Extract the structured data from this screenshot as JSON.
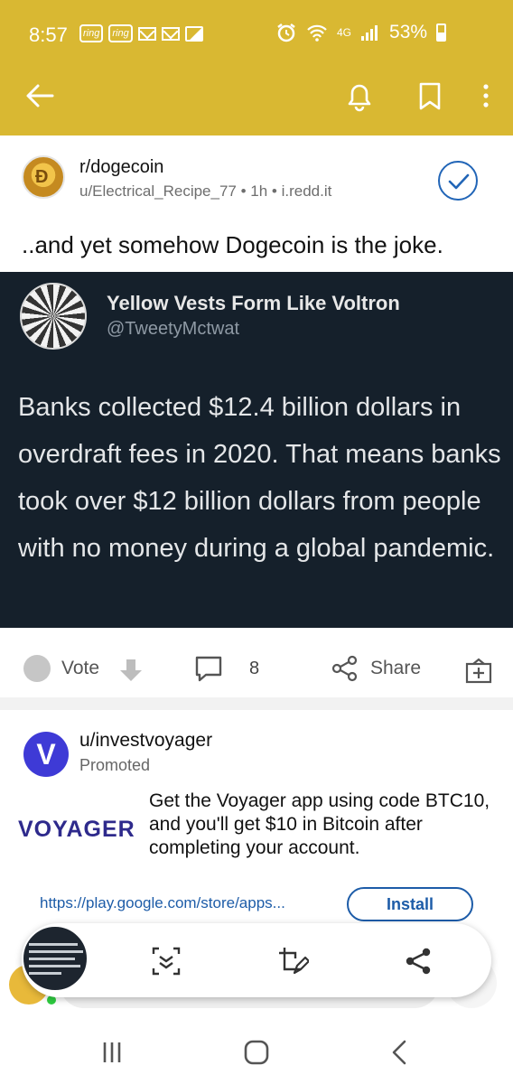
{
  "status_bar": {
    "time": "8:57",
    "ring_label_1": "ring",
    "ring_label_2": "ring",
    "network": "4G",
    "battery": "53%"
  },
  "app_bar": {
    "back_icon": "arrow-left-icon",
    "icons": [
      "bell-icon",
      "bookmark-icon",
      "more-vert-icon"
    ],
    "color": "#d9b832"
  },
  "post": {
    "subreddit": "r/dogecoin",
    "meta": "u/Electrical_Recipe_77 • 1h • i.redd.it",
    "title": "..and yet somehow Dogecoin is the joke.",
    "tweet": {
      "name": "Yellow Vests Form Like Voltron",
      "handle": "@TweetyMctwat",
      "body": "Banks collected $12.4 billion dollars in overdraft fees in 2020. That means banks took over $12 billion dollars from people with no money during a global pandemic."
    },
    "actions": {
      "vote_label": "Vote",
      "comment_count": "8",
      "share_label": "Share"
    }
  },
  "promoted": {
    "avatar_letter": "V",
    "user": "u/investvoyager",
    "label": "Promoted",
    "logo_text": "VOYAGER",
    "text": "Get the Voyager app using code BTC10, and you'll get $10 in Bitcoin after completing your account.",
    "url": "https://play.google.com/store/apps...",
    "install_label": "Install"
  },
  "screenshot_toolbar": {
    "icons": [
      "scroll-capture-icon",
      "crop-edit-icon",
      "share-icon"
    ]
  },
  "nav_bar": {
    "icons": [
      "recents-icon",
      "home-icon",
      "back-icon"
    ]
  },
  "colors": {
    "accent": "#d9b832",
    "link": "#1d5ca8",
    "tweet_bg": "#15202b",
    "voyager": "#2e2a8c"
  }
}
